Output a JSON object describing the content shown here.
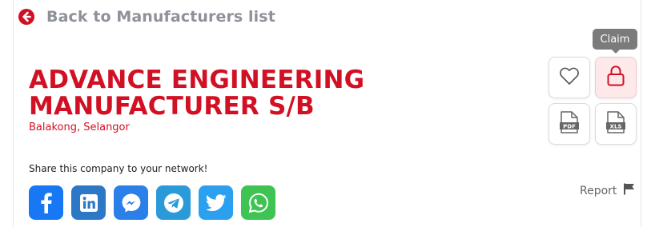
{
  "back": {
    "label": "Back to Manufacturers list",
    "icon": "arrow-left-circle-icon"
  },
  "company": {
    "name": "ADVANCE ENGINEERING MANUFACTURER S/B",
    "location": "Balakong, Selangor"
  },
  "share": {
    "label": "Share this company to your network!",
    "networks": [
      {
        "name": "facebook",
        "icon": "facebook-icon",
        "color": "#1877f2"
      },
      {
        "name": "linkedin",
        "icon": "linkedin-icon",
        "color": "#2c78c6"
      },
      {
        "name": "messenger",
        "icon": "messenger-icon",
        "color": "#2a7fe8"
      },
      {
        "name": "telegram",
        "icon": "telegram-icon",
        "color": "#2a9ad8"
      },
      {
        "name": "twitter",
        "icon": "twitter-icon",
        "color": "#2ba0ee"
      },
      {
        "name": "whatsapp",
        "icon": "whatsapp-icon",
        "color": "#3fc352"
      }
    ]
  },
  "actions": {
    "favorite": {
      "icon": "heart-icon"
    },
    "claim": {
      "icon": "lock-icon",
      "tooltip": "Claim"
    },
    "pdf": {
      "icon": "pdf-file-icon",
      "label": "PDF"
    },
    "xls": {
      "icon": "xls-file-icon",
      "label": "XLS"
    }
  },
  "report": {
    "label": "Report",
    "icon": "flag-icon"
  },
  "colors": {
    "brand": "#d21024",
    "muted": "#8e9199",
    "tooltip": "#7b7b7b"
  }
}
